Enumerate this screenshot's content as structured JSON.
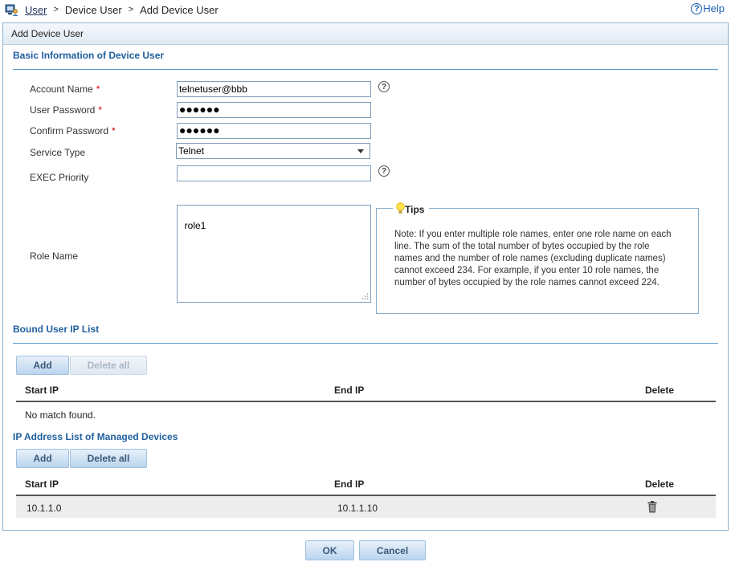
{
  "breadcrumb": {
    "items": [
      "User",
      "Device User",
      "Add Device User"
    ],
    "separator": ">"
  },
  "help": {
    "label": "Help",
    "glyph": "?"
  },
  "panel": {
    "title": "Add Device User"
  },
  "basic": {
    "title": "Basic Information of Device User",
    "account_label": "Account Name",
    "account_value": "telnetuser@bbb",
    "password_label": "User Password",
    "password_value": "●●●●●●",
    "confirm_label": "Confirm Password",
    "confirm_value": "●●●●●●",
    "service_label": "Service Type",
    "service_value": "Telnet",
    "exec_label": "EXEC Priority",
    "exec_value": "",
    "role_label": "Role Name",
    "role_value": "role1",
    "required_mark": "*",
    "q_glyph": "?"
  },
  "tips": {
    "title": "Tips",
    "text": "Note: If you enter multiple role names, enter one role name on each line. The sum of the total number of bytes occupied by the role names and the number of role names (excluding duplicate names) cannot exceed 234. For example, if you enter 10 role names, the number of bytes occupied by the role names cannot exceed 224."
  },
  "bound_ip": {
    "title": "Bound User IP List",
    "add_label": "Add",
    "delete_all_label": "Delete all",
    "columns": [
      "Start IP",
      "End IP",
      "Delete"
    ],
    "empty_text": "No match found."
  },
  "managed_ip": {
    "title": "IP Address List of Managed Devices",
    "add_label": "Add",
    "delete_all_label": "Delete all",
    "columns": [
      "Start IP",
      "End IP",
      "Delete"
    ],
    "rows": [
      {
        "start": "10.1.1.0",
        "end": "10.1.1.10"
      }
    ]
  },
  "footer": {
    "ok_label": "OK",
    "cancel_label": "Cancel"
  },
  "colors": {
    "accent": "#1f5f9e",
    "required": "#d40000",
    "border": "#8db2cf"
  }
}
